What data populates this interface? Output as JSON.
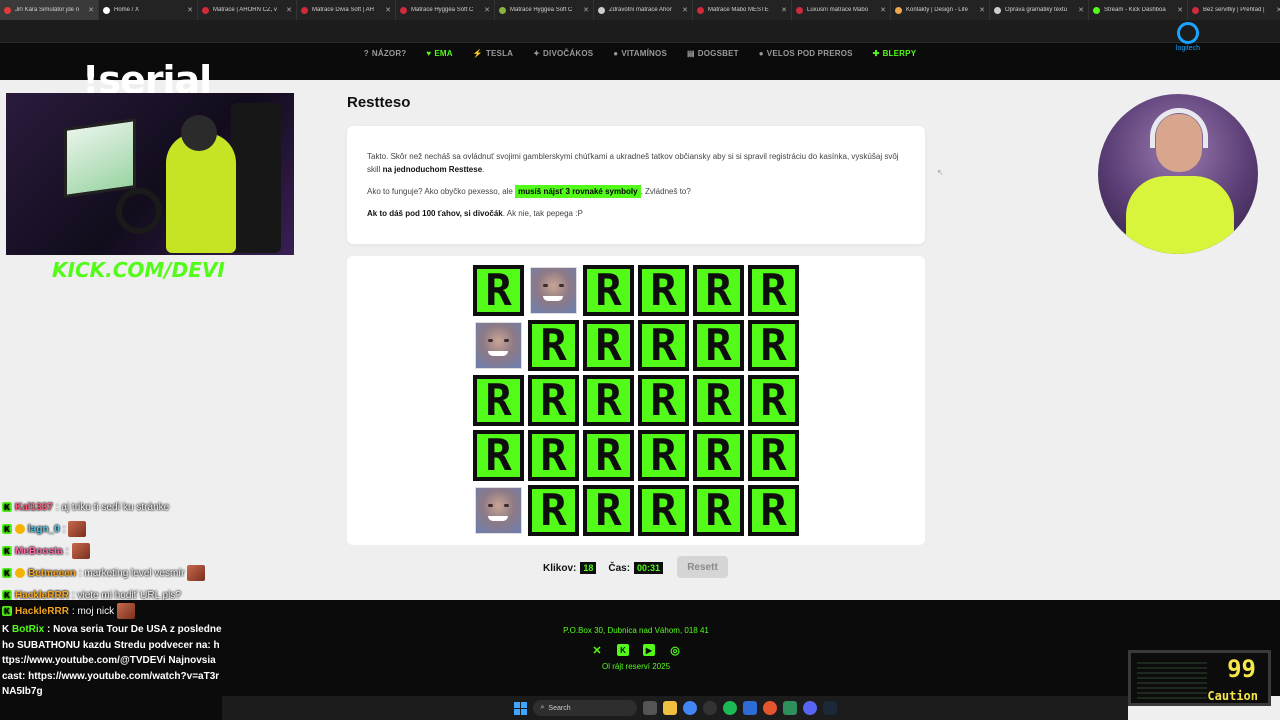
{
  "browser": {
    "tabs": [
      {
        "label": "Jiří Kára Simulátor jde n",
        "color": "#e23b3b"
      },
      {
        "label": "Home / X",
        "color": "#ffffff"
      },
      {
        "label": "Matrace | AHORN CZ, v",
        "color": "#d12a3b"
      },
      {
        "label": "Matrace Divia Soft | AH",
        "color": "#d12a3b"
      },
      {
        "label": "Matrace Hyggea Soft C",
        "color": "#d12a3b"
      },
      {
        "label": "Matrace Hyggea Soft C",
        "color": "#8ab340"
      },
      {
        "label": "Zdravotní matrace Ahor",
        "color": "#cccccc"
      },
      {
        "label": "Matrace Mabo MESTE",
        "color": "#d12a3b"
      },
      {
        "label": "Luxusní matrace Mabo",
        "color": "#d12a3b"
      },
      {
        "label": "Kontakty | Design - Life",
        "color": "#f0a64a"
      },
      {
        "label": "Oprava gramatiky textu",
        "color": "#cccccc"
      },
      {
        "label": "Stream - Kick Dashboa",
        "color": "#53fc18"
      },
      {
        "label": "Bez servifky | Prehľad |",
        "color": "#d12a3b"
      }
    ]
  },
  "nav": {
    "items": [
      {
        "icon": "?",
        "label": "NÁZOR?",
        "active": false
      },
      {
        "icon": "♥",
        "label": "EMA",
        "active": true
      },
      {
        "icon": "⚡",
        "label": "TESLA",
        "active": false
      },
      {
        "icon": "✦",
        "label": "DIVOČÁKOS",
        "active": false
      },
      {
        "icon": "●",
        "label": "VITAMÍNOS",
        "active": false
      },
      {
        "icon": "▤",
        "label": "DOGSBET",
        "active": false
      },
      {
        "icon": "●",
        "label": "VELOS POD PREROS",
        "active": false
      },
      {
        "icon": "✚",
        "label": "BLERPY",
        "active": true
      }
    ],
    "logo_text": "logitech"
  },
  "overlay": {
    "serial": "!serial",
    "kick_url": "KICK.COM/DEVI"
  },
  "chat": {
    "lines": [
      {
        "user": "Kal1337",
        "user_color": "#ff5a7a",
        "message": ": aj triko ti sedí ku stránke",
        "emote": false,
        "badge": false
      },
      {
        "user": "lagn_0",
        "user_color": "#53c6e8",
        "message": ":",
        "emote": true,
        "badge": true
      },
      {
        "user": "MeBoosta",
        "user_color": "#ff6aa6",
        "message": ":",
        "emote": true,
        "badge": false
      },
      {
        "user": "Betmeeen",
        "user_color": "#f5a623",
        "message": ": marketing level vesmír",
        "emote": true,
        "badge": true
      },
      {
        "user": "HackleRRR",
        "user_color": "#f5a623",
        "message": ": viete mi hodiť URL pls?",
        "emote": false,
        "badge": false
      },
      {
        "user": "HackleRRR",
        "user_color": "#f5a623",
        "message": ": moj nick",
        "emote": true,
        "badge": false
      }
    ],
    "bot": {
      "user": "BotRix",
      "message": ": Nova seria Tour De USA z posledneho SUBATHONU kazdu Stredu podvecer na: https://www.youtube.com/@TVDEVi Najnovsia cast: https://www.youtube.com/watch?v=aT3rNA5Ib7g"
    }
  },
  "main": {
    "title": "Restteso",
    "intro": "Takto. Skôr než necháš sa ovládnuť svojimi gamblerskymi chúťkami a ukradneš tatkov občiansky aby si si spravil registráciu do kasínka, vyskúšaj svôj skill",
    "intro_bold": "na jednoduchom Resttese",
    "intro_end": ".",
    "how_prefix": "Ako to funguje? Ako obyčko pexesso, ale",
    "how_highlight": "musíš nájsť 3 rovnaké symboly",
    "how_suffix": ". Zvládneš to?",
    "tip_bold": "Ak to dáš pod 100 ťahov, si divočák",
    "tip_rest": ". Ak nie, tak pepega :P"
  },
  "game": {
    "tile_letter": "R",
    "tiles": [
      "down",
      "up",
      "down",
      "down",
      "down",
      "down",
      "up",
      "down",
      "down",
      "down",
      "down",
      "down",
      "down",
      "down",
      "down",
      "down",
      "down",
      "down",
      "down",
      "down",
      "down",
      "down",
      "down",
      "down",
      "up",
      "down",
      "down",
      "down",
      "down",
      "down"
    ],
    "clicks_label": "Klikov:",
    "clicks": "18",
    "time_label": "Čas:",
    "time": "00:31",
    "reset_label": "Resett"
  },
  "footer": {
    "address": "P.O.Box 30, Dubnica nad Váhom, 018 41",
    "copyright": "Ol rájt reserví 2025"
  },
  "widget": {
    "number": "99",
    "status": "Caution"
  },
  "taskbar": {
    "search_placeholder": "Search"
  },
  "colors": {
    "accent": "#53fc18",
    "dark": "#0b0b0b"
  }
}
